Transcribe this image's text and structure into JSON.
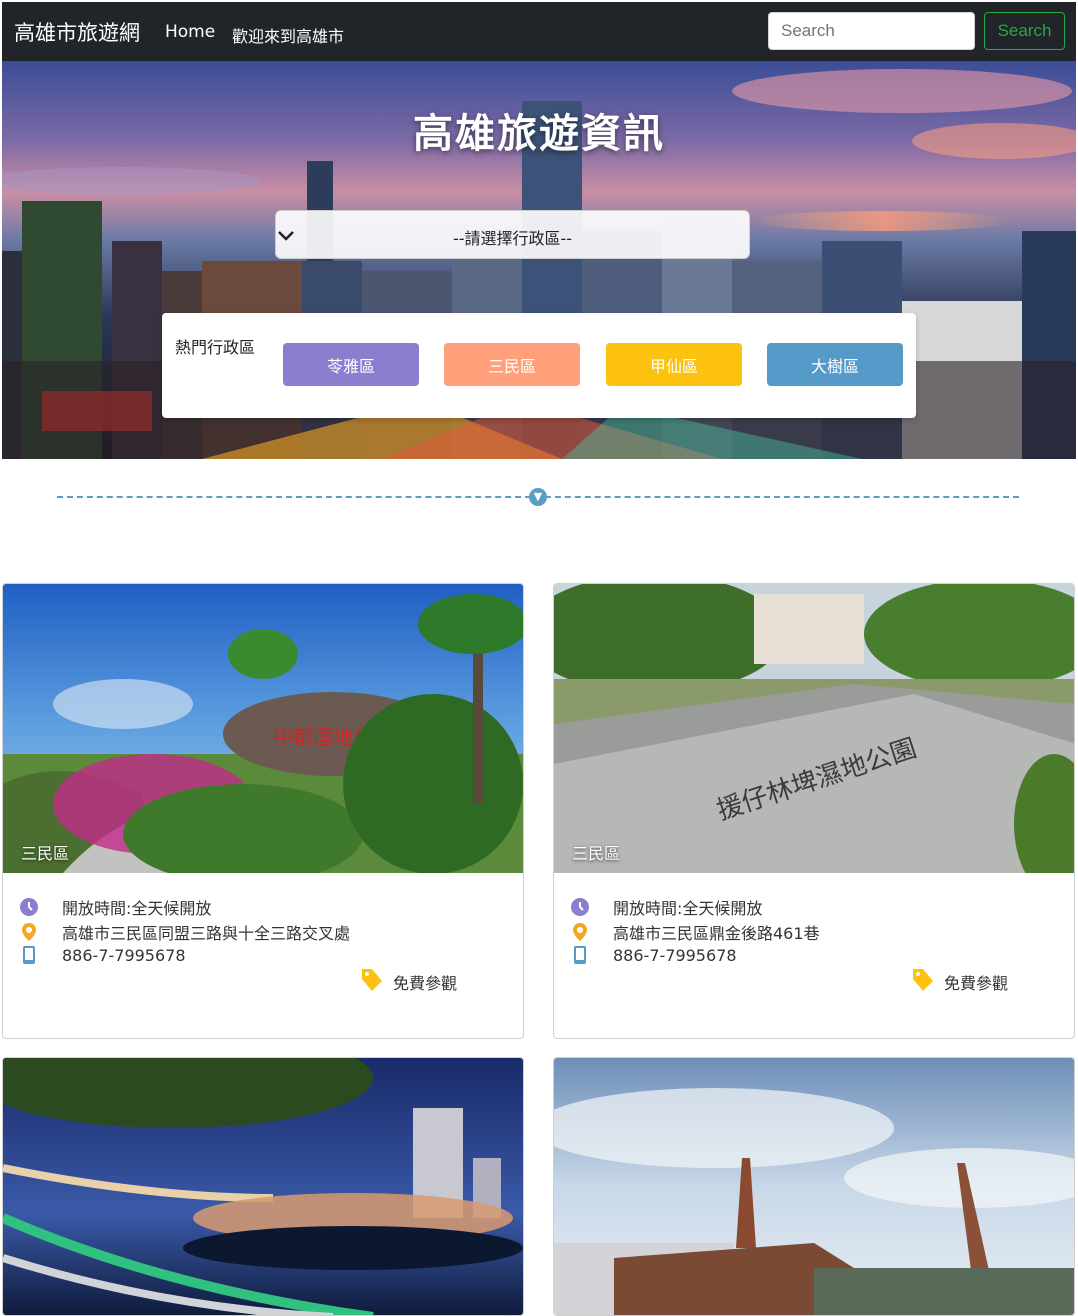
{
  "navbar": {
    "brand": "高雄市旅遊網",
    "home": "Home",
    "welcome": "歡迎來到高雄市",
    "search_placeholder": "Search",
    "search_button": "Search"
  },
  "hero": {
    "title": "高雄旅遊資訊",
    "select_value": "--請選擇行政區--",
    "popular_label": "熱門行政區",
    "districts": [
      {
        "label": "苓雅區",
        "color": "#8a7fcf"
      },
      {
        "label": "三民區",
        "color": "#ffa07a"
      },
      {
        "label": "甲仙區",
        "color": "#fdc20f"
      },
      {
        "label": "大樹區",
        "color": "#559ac8"
      }
    ]
  },
  "cards": [
    {
      "zone": "三民區",
      "hours": "開放時間:全天候開放",
      "address": "高雄市三民區同盟三路與十全三路交叉處",
      "phone": "886-7-7995678",
      "ticket": "免費參觀"
    },
    {
      "zone": "三民區",
      "hours": "開放時間:全天候開放",
      "address": "高雄市三民區鼎金後路461巷",
      "phone": "886-7-7995678",
      "ticket": "免費參觀"
    },
    {},
    {}
  ],
  "colors": {
    "navbar_bg": "#212529",
    "accent_green": "#28a745",
    "divider": "#5a9ec2",
    "clock_icon": "#8a7fcf",
    "pin_icon": "#f5a623",
    "phone_icon": "#559ac8",
    "tag_icon": "#fdc20f"
  },
  "icons": [
    "clock-icon",
    "map-pin-icon",
    "phone-icon",
    "price-tag-icon",
    "chevron-down-icon",
    "arrow-down-icon"
  ]
}
